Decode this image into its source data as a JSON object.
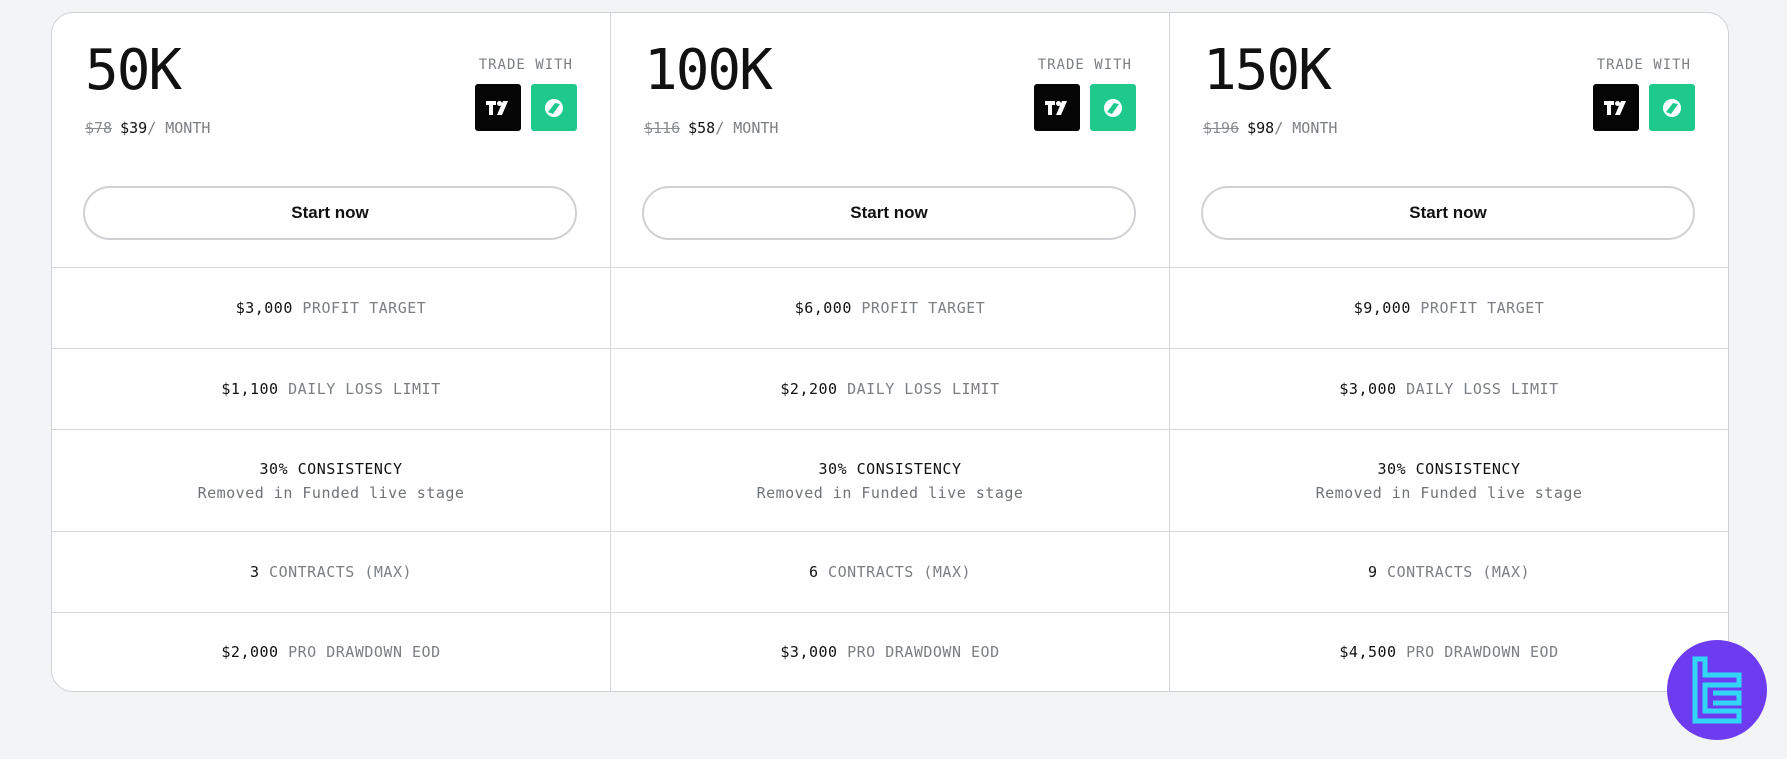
{
  "plans": [
    {
      "size": "50K",
      "old_price": "$78",
      "price": "$39",
      "per_month": "/ MONTH",
      "trade_with": "TRADE WITH",
      "cta": "Start now",
      "profit_target": {
        "value": "$3,000",
        "label": "PROFIT TARGET"
      },
      "daily_loss": {
        "value": "$1,100",
        "label": "DAILY LOSS LIMIT"
      },
      "consistency": {
        "value": "30% CONSISTENCY",
        "note": "Removed in Funded live stage"
      },
      "contracts": {
        "value": "3",
        "label": "CONTRACTS (MAX)"
      },
      "drawdown": {
        "value": "$2,000",
        "label": "PRO DRAWDOWN EOD"
      }
    },
    {
      "size": "100K",
      "old_price": "$116",
      "price": "$58",
      "per_month": "/ MONTH",
      "trade_with": "TRADE WITH",
      "cta": "Start now",
      "profit_target": {
        "value": "$6,000",
        "label": "PROFIT TARGET"
      },
      "daily_loss": {
        "value": "$2,200",
        "label": "DAILY LOSS LIMIT"
      },
      "consistency": {
        "value": "30% CONSISTENCY",
        "note": "Removed in Funded live stage"
      },
      "contracts": {
        "value": "6",
        "label": "CONTRACTS (MAX)"
      },
      "drawdown": {
        "value": "$3,000",
        "label": "PRO DRAWDOWN EOD"
      }
    },
    {
      "size": "150K",
      "old_price": "$196",
      "price": "$98",
      "per_month": "/ MONTH",
      "trade_with": "TRADE WITH",
      "cta": "Start now",
      "profit_target": {
        "value": "$9,000",
        "label": "PROFIT TARGET"
      },
      "daily_loss": {
        "value": "$3,000",
        "label": "DAILY LOSS LIMIT"
      },
      "consistency": {
        "value": "30% CONSISTENCY",
        "note": "Removed in Funded live stage"
      },
      "contracts": {
        "value": "9",
        "label": "CONTRACTS (MAX)"
      },
      "drawdown": {
        "value": "$4,500",
        "label": "PRO DRAWDOWN EOD"
      }
    }
  ],
  "icons": {
    "tradingview": "tradingview-icon",
    "ninja": "ninjatrader-icon",
    "brand": "brand-logo-icon"
  },
  "colors": {
    "tradingview_bg": "#050505",
    "ninja_bg": "#1ec98b",
    "badge_bg": "#6d3cf0",
    "badge_glyph": "#31d6f5"
  }
}
